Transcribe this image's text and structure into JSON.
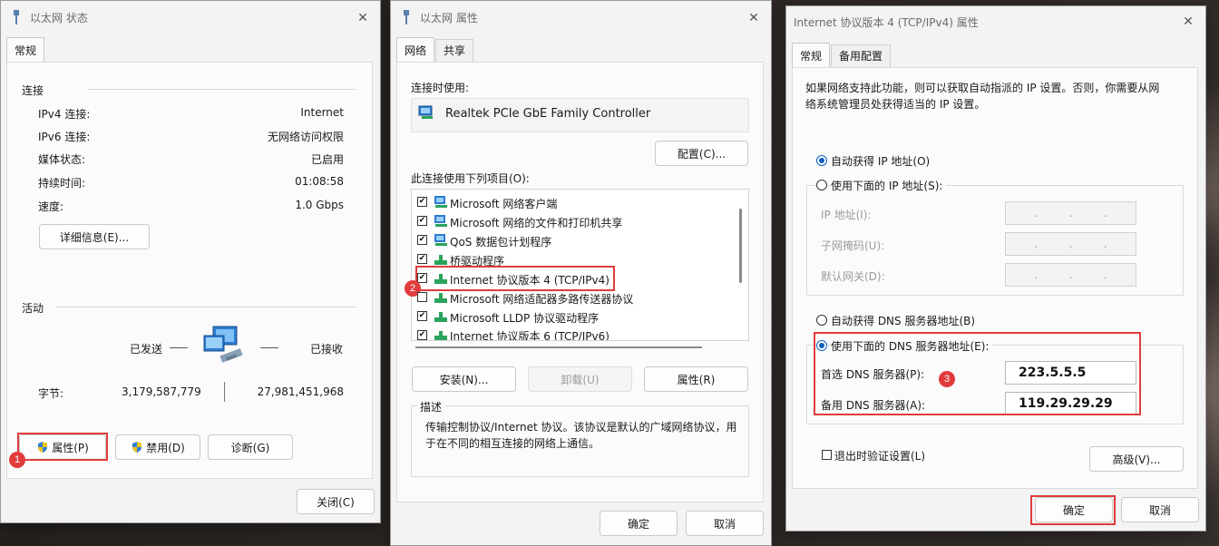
{
  "status_window": {
    "title": "以太网 状态",
    "tab_general": "常规",
    "section_connection": "连接",
    "rows": [
      {
        "label": "IPv4 连接:",
        "value": "Internet"
      },
      {
        "label": "IPv6 连接:",
        "value": "无网络访问权限"
      },
      {
        "label": "媒体状态:",
        "value": "已启用"
      },
      {
        "label": "持续时间:",
        "value": "01:08:58"
      },
      {
        "label": "速度:",
        "value": "1.0 Gbps"
      }
    ],
    "details_button": "详细信息(E)...",
    "section_activity": "活动",
    "sent_label": "已发送",
    "received_label": "已接收",
    "bytes_label": "字节:",
    "bytes_sent": "3,179,587,779",
    "bytes_received": "27,981,451,968",
    "properties_button": "属性(P)",
    "disable_button": "禁用(D)",
    "diagnose_button": "诊断(G)",
    "close_button": "关闭(C)",
    "badge": "1"
  },
  "properties_window": {
    "title": "以太网 属性",
    "tab_network": "网络",
    "tab_sharing": "共享",
    "connect_using_label": "连接时使用:",
    "adapter_name": "Realtek PCIe GbE Family Controller",
    "configure_button": "配置(C)...",
    "items_label": "此连接使用下列项目(O):",
    "items": [
      {
        "label": "Microsoft 网络客户端",
        "checked": true,
        "icon": "network-client-icon"
      },
      {
        "label": "Microsoft 网络的文件和打印机共享",
        "checked": true,
        "icon": "network-client-icon"
      },
      {
        "label": "QoS 数据包计划程序",
        "checked": true,
        "icon": "network-client-icon"
      },
      {
        "label": "桥驱动程序",
        "checked": true,
        "icon": "protocol-icon"
      },
      {
        "label": "Internet 协议版本 4 (TCP/IPv4)",
        "checked": true,
        "icon": "protocol-icon"
      },
      {
        "label": "Microsoft 网络适配器多路传送器协议",
        "checked": false,
        "icon": "protocol-icon"
      },
      {
        "label": "Microsoft LLDP 协议驱动程序",
        "checked": true,
        "icon": "protocol-icon"
      },
      {
        "label": "Internet 协议版本 6 (TCP/IPv6)",
        "checked": true,
        "icon": "protocol-icon"
      }
    ],
    "install_button": "安装(N)...",
    "uninstall_button": "卸载(U)",
    "properties_button": "属性(R)",
    "description_label": "描述",
    "description_text": "传输控制协议/Internet 协议。该协议是默认的广域网络协议，用于在不同的相互连接的网络上通信。",
    "ok_button": "确定",
    "cancel_button": "取消",
    "badge": "2"
  },
  "ipv4_window": {
    "title": "Internet 协议版本 4 (TCP/IPv4) 属性",
    "tab_general": "常规",
    "tab_alternate": "备用配置",
    "intro_text": "如果网络支持此功能，则可以获取自动指派的 IP 设置。否则，你需要从网络系统管理员处获得适当的 IP 设置。",
    "auto_ip_label": "自动获得 IP 地址(O)",
    "manual_ip_label": "使用下面的 IP 地址(S):",
    "ip_address_label": "IP 地址(I):",
    "subnet_label": "子网掩码(U):",
    "gateway_label": "默认网关(D):",
    "empty_ip_dot": ".",
    "auto_dns_label": "自动获得 DNS 服务器地址(B)",
    "manual_dns_label": "使用下面的 DNS 服务器地址(E):",
    "preferred_dns_label": "首选 DNS 服务器(P):",
    "preferred_dns_value": "223.5.5.5",
    "alternate_dns_label": "备用 DNS 服务器(A):",
    "alternate_dns_value": "119.29.29.29",
    "validate_label": "退出时验证设置(L)",
    "advanced_button": "高级(V)...",
    "ok_button": "确定",
    "cancel_button": "取消",
    "badge": "3"
  }
}
